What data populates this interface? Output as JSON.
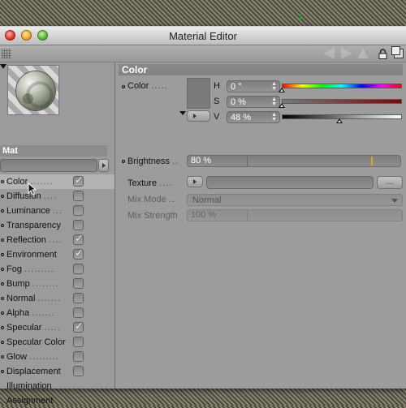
{
  "window": {
    "title": "Material Editor"
  },
  "material": {
    "name": "Mat"
  },
  "channels": [
    {
      "label": "Color",
      "dots": ".......",
      "checked": true
    },
    {
      "label": "Diffusion",
      "dots": "....",
      "checked": false
    },
    {
      "label": "Luminance",
      "dots": "...",
      "checked": false
    },
    {
      "label": "Transparency",
      "dots": "",
      "checked": false
    },
    {
      "label": "Reflection",
      "dots": "....",
      "checked": true
    },
    {
      "label": "Environment",
      "dots": "",
      "checked": true
    },
    {
      "label": "Fog",
      "dots": ".........",
      "checked": false
    },
    {
      "label": "Bump",
      "dots": "........",
      "checked": false
    },
    {
      "label": "Normal",
      "dots": ".......",
      "checked": false
    },
    {
      "label": "Alpha",
      "dots": ".......",
      "checked": false
    },
    {
      "label": "Specular",
      "dots": ".....",
      "checked": true
    },
    {
      "label": "Specular Color",
      "dots": "",
      "checked": false
    },
    {
      "label": "Glow",
      "dots": ".........",
      "checked": false
    },
    {
      "label": "Displacement",
      "dots": "",
      "checked": false
    }
  ],
  "extra_items": {
    "illumination": "Illumination",
    "assignment": "Assignment"
  },
  "color_section": {
    "header": "Color",
    "color_label": "Color",
    "color_dots": ".....",
    "h_label": "H",
    "h_value": "0 °",
    "s_label": "S",
    "s_value": "0 %",
    "v_label": "V",
    "v_value": "48 %",
    "hue_level": 0.0,
    "sat_level": 0.0,
    "val_level": 0.48,
    "brightness_label": "Brightness",
    "brightness_dots": "..",
    "brightness_value": "80 %",
    "texture_label": "Texture",
    "texture_dots": "....",
    "texture_button": "...",
    "mix_mode_label": "Mix Mode",
    "mix_mode_dots": "..",
    "mix_mode_value": "Normal",
    "mix_strength_label": "Mix Strength",
    "mix_strength_value": "100 %"
  },
  "colors": {
    "hue_gradient": "rainbow",
    "brightness_marker": "#e8a020",
    "panel": "#9c9c9c",
    "header": "#8a8a8a"
  }
}
